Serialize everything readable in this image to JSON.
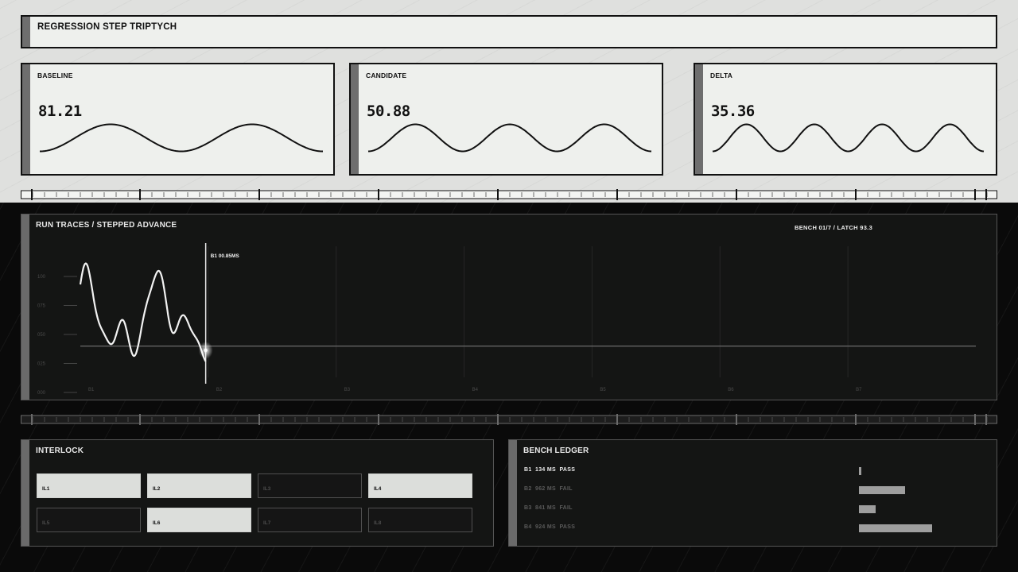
{
  "header": {
    "title": "REGRESSION STEP TRIPTYCH"
  },
  "cards": [
    {
      "label": "BASELINE",
      "value": "81.21",
      "cycles": 2
    },
    {
      "label": "CANDIDATE",
      "value": "50.88",
      "cycles": 3
    },
    {
      "label": "DELTA",
      "value": "35.36",
      "cycles": 4
    }
  ],
  "traces": {
    "title": "RUN TRACES / STEPPED ADVANCE",
    "status": "BENCH 01/7 / LATCH 93.3",
    "cursor_label": "B1 00.85MS",
    "y_ticks": [
      "100",
      "075",
      "050",
      "025",
      "000"
    ],
    "x_ticks": [
      "B1",
      "B2",
      "B3",
      "B4",
      "B5",
      "B6",
      "B7"
    ],
    "baseline_level": 0.4,
    "cursor_fraction": 0.14
  },
  "interlock": {
    "title": "INTERLOCK",
    "items": [
      {
        "label": "IL1",
        "active": true
      },
      {
        "label": "IL2",
        "active": true
      },
      {
        "label": "IL3",
        "active": false
      },
      {
        "label": "IL4",
        "active": true
      },
      {
        "label": "IL5",
        "active": false
      },
      {
        "label": "IL6",
        "active": true
      },
      {
        "label": "IL7",
        "active": false
      },
      {
        "label": "IL8",
        "active": false
      }
    ]
  },
  "ledger": {
    "title": "BENCH LEDGER",
    "rows": [
      {
        "text": "B1  134 MS  PASS",
        "ms": 134,
        "highlight": true
      },
      {
        "text": "B2  962 MS  FAIL",
        "ms": 962,
        "highlight": false
      },
      {
        "text": "B3  841 MS  FAIL",
        "ms": 841,
        "highlight": false
      },
      {
        "text": "B4  924 MS  PASS",
        "ms": 924,
        "highlight": false
      }
    ]
  }
}
